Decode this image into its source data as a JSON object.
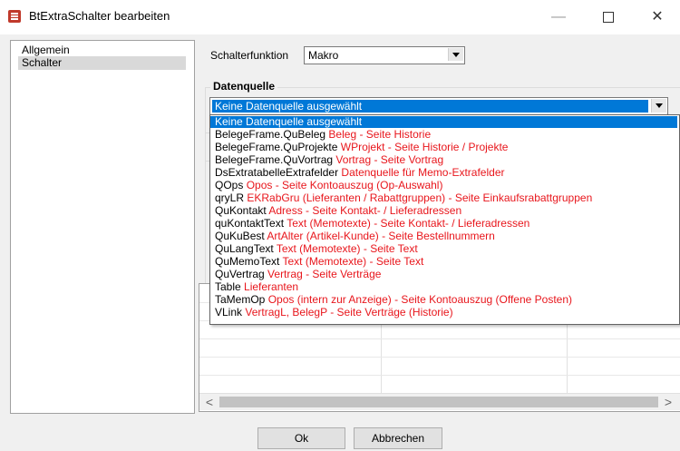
{
  "window": {
    "title": "BtExtraSchalter bearbeiten",
    "minimize": "—",
    "close": "✕"
  },
  "nav": {
    "items": [
      {
        "label": "Allgemein"
      },
      {
        "label": "Schalter"
      }
    ]
  },
  "schalterfunktion": {
    "label": "Schalterfunktion",
    "value": "Makro"
  },
  "datenquelle": {
    "title": "Datenquelle",
    "selected": "Keine Datenquelle ausgewählt",
    "options": [
      {
        "name": "Keine Datenquelle ausgewählt",
        "desc": ""
      },
      {
        "name": "BelegeFrame.QuBeleg",
        "desc": "Beleg - Seite Historie"
      },
      {
        "name": "BelegeFrame.QuProjekte",
        "desc": "WProjekt - Seite Historie / Projekte"
      },
      {
        "name": "BelegeFrame.QuVortrag",
        "desc": "Vortrag - Seite Vortrag"
      },
      {
        "name": "DsExtratabelleExtrafelder",
        "desc": "Datenquelle für Memo-Extrafelder"
      },
      {
        "name": "QOps",
        "desc": "Opos - Seite Kontoauszug (Op-Auswahl)"
      },
      {
        "name": "qryLR",
        "desc": "EKRabGru (Lieferanten / Rabattgruppen) - Seite Einkaufsrabattgruppen"
      },
      {
        "name": "QuKontakt",
        "desc": "Adress - Seite Kontakt- / Lieferadressen"
      },
      {
        "name": "quKontaktText",
        "desc": "Text (Memotexte) - Seite Kontakt- / Lieferadressen"
      },
      {
        "name": "QuKuBest",
        "desc": "ArtAlter (Artikel-Kunde) - Seite Bestellnummern"
      },
      {
        "name": "QuLangText",
        "desc": "Text (Memotexte) - Seite Text"
      },
      {
        "name": "QuMemoText",
        "desc": "Text (Memotexte) - Seite Text"
      },
      {
        "name": "QuVertrag",
        "desc": "Vertrag - Seite Verträge"
      },
      {
        "name": "Table",
        "desc": "Lieferanten"
      },
      {
        "name": "TaMemOp",
        "desc": "Opos (intern zur Anzeige) - Seite Kontoauszug (Offene Posten)"
      },
      {
        "name": "VLink",
        "desc": "VertragL, BelegP - Seite Verträge (Historie)"
      }
    ]
  },
  "grid": {
    "scroll_left": "<",
    "scroll_right": ">"
  },
  "buttons": {
    "ok": "Ok",
    "cancel": "Abbrechen"
  },
  "colors": {
    "selection": "#0078d7",
    "description_text": "#e8161c"
  }
}
